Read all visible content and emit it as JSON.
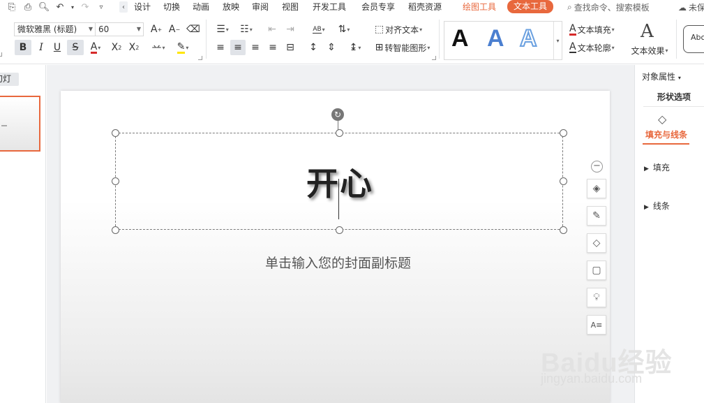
{
  "menubar": {
    "tabs": [
      "设计",
      "切换",
      "动画",
      "放映",
      "审阅",
      "视图",
      "开发工具",
      "会员专享",
      "稻壳资源"
    ],
    "draw_tool": "绘图工具",
    "text_tool": "文本工具",
    "search_placeholder": "查找命令、搜索模板",
    "cloud_status": "未保存"
  },
  "ribbon": {
    "font_name": "微软雅黑 (标题)",
    "font_size": "60",
    "align_text_label": "对齐文本",
    "smart_shape_label": "转智能图形",
    "text_fill_label": "文本填充",
    "text_outline_label": "文本轮廓",
    "text_effect_label": "文本效果",
    "style_gallery": [
      "A",
      "A",
      "A"
    ],
    "partial_label": "Abc",
    "accent_color": "#e8683d",
    "font_color_bar": "#d62a2a",
    "highlight_bar": "#ffe600"
  },
  "left_panel": {
    "tab_label": "幻灯片"
  },
  "slide": {
    "title": "开心",
    "subtitle_placeholder": "单击输入您的封面副标题"
  },
  "right_panel": {
    "title": "对象属性",
    "tab": "形状选项",
    "subtab": "填充与线条",
    "items": [
      "填充",
      "线条"
    ]
  },
  "watermark": {
    "text": "Baidu经验",
    "sub": "jingyan.baidu.com"
  }
}
